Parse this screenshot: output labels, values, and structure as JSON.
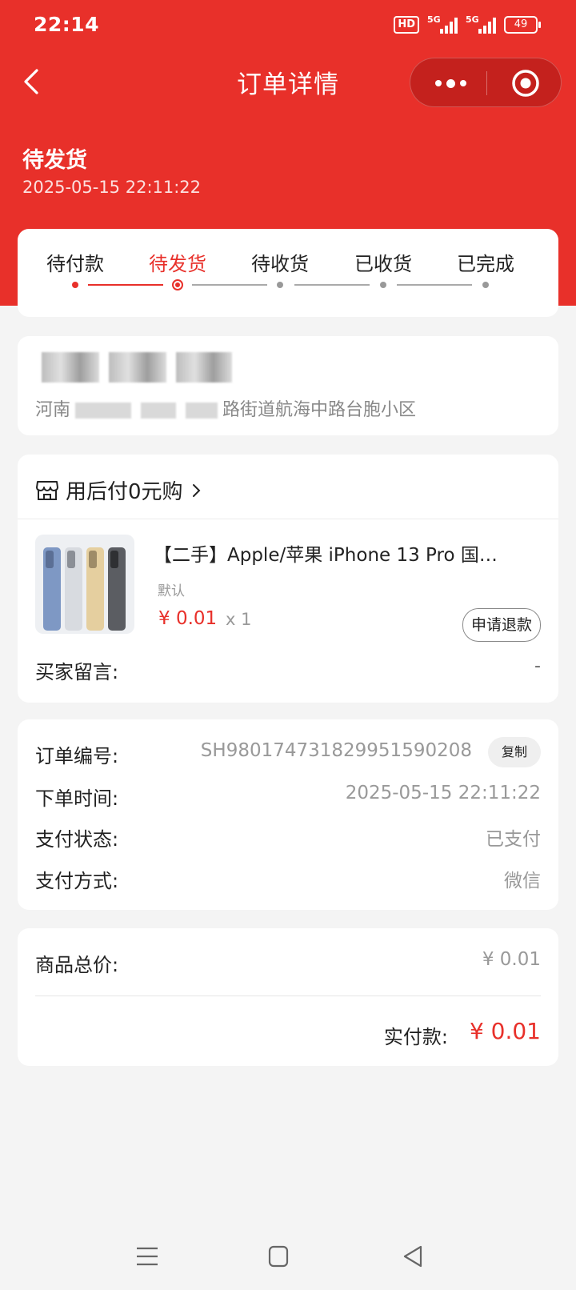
{
  "status_bar": {
    "time": "22:14",
    "hd": "HD",
    "network1": "5G",
    "network2": "5G",
    "battery": "49"
  },
  "nav": {
    "title": "订单详情"
  },
  "order": {
    "status": "待发货",
    "created_time": "2025-05-15 22:11:22"
  },
  "progress": {
    "steps": [
      "待付款",
      "待发货",
      "待收货",
      "已收货",
      "已完成"
    ],
    "current_index": 1
  },
  "address": {
    "line_visible_end": "路街道航海中路台胞小区",
    "line_visible_start": "河南"
  },
  "product": {
    "store_name": "用后付0元购",
    "title": "【二手】Apple/苹果 iPhone 13 Pro 国…",
    "spec": "默认",
    "price": "¥ 0.01",
    "qty": "x 1",
    "refund_label": "申请退款",
    "buyer_msg_label": "买家留言:",
    "buyer_msg_value": "-"
  },
  "info": {
    "order_no_label": "订单编号:",
    "order_no": "SH980174731829951590208",
    "copy_label": "复制",
    "order_time_label": "下单时间:",
    "order_time": "2025-05-15 22:11:22",
    "pay_status_label": "支付状态:",
    "pay_status": "已支付",
    "pay_method_label": "支付方式:",
    "pay_method": "微信"
  },
  "totals": {
    "goods_total_label": "商品总价:",
    "goods_total": "¥ 0.01",
    "paid_label": "实付款:",
    "paid": "¥ 0.01"
  },
  "colors": {
    "brand": "#e8302a",
    "capsule": "#c4211d"
  }
}
